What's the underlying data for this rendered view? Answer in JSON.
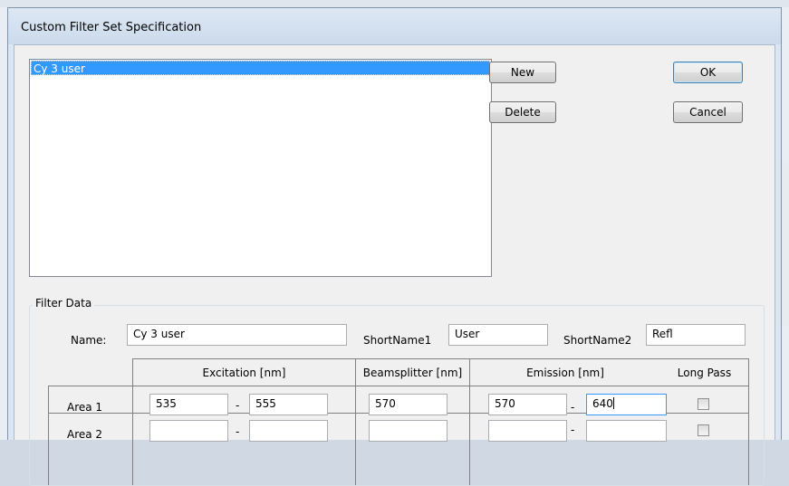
{
  "dialog": {
    "title": "Custom Filter Set Specification",
    "filter_sets": [
      "Cy 3 user"
    ],
    "buttons": {
      "new": "New",
      "delete": "Delete",
      "ok": "OK",
      "cancel": "Cancel"
    }
  },
  "filter_data": {
    "group_label": "Filter Data",
    "name_label": "Name:",
    "name_value": "Cy 3 user",
    "shortname1_label": "ShortName1",
    "shortname1_value": "User",
    "shortname2_label": "ShortName2",
    "shortname2_value": "Refl",
    "headers": {
      "excitation": "Excitation [nm]",
      "beamsplitter": "Beamsplitter [nm]",
      "emission": "Emission [nm]",
      "long_pass": "Long Pass"
    },
    "rows": [
      {
        "label": "Area 1",
        "ex_from": "535",
        "ex_to": "555",
        "bs": "570",
        "em_from": "570",
        "em_to": "640",
        "long_pass": false
      },
      {
        "label": "Area 2",
        "ex_from": "",
        "ex_to": "",
        "bs": "",
        "em_from": "",
        "em_to": "",
        "long_pass": false
      }
    ],
    "dash": "-"
  },
  "colors": {
    "selection": "#3399ff",
    "dialog_frame": "#dce6f2",
    "client": "#f0f0f0"
  }
}
